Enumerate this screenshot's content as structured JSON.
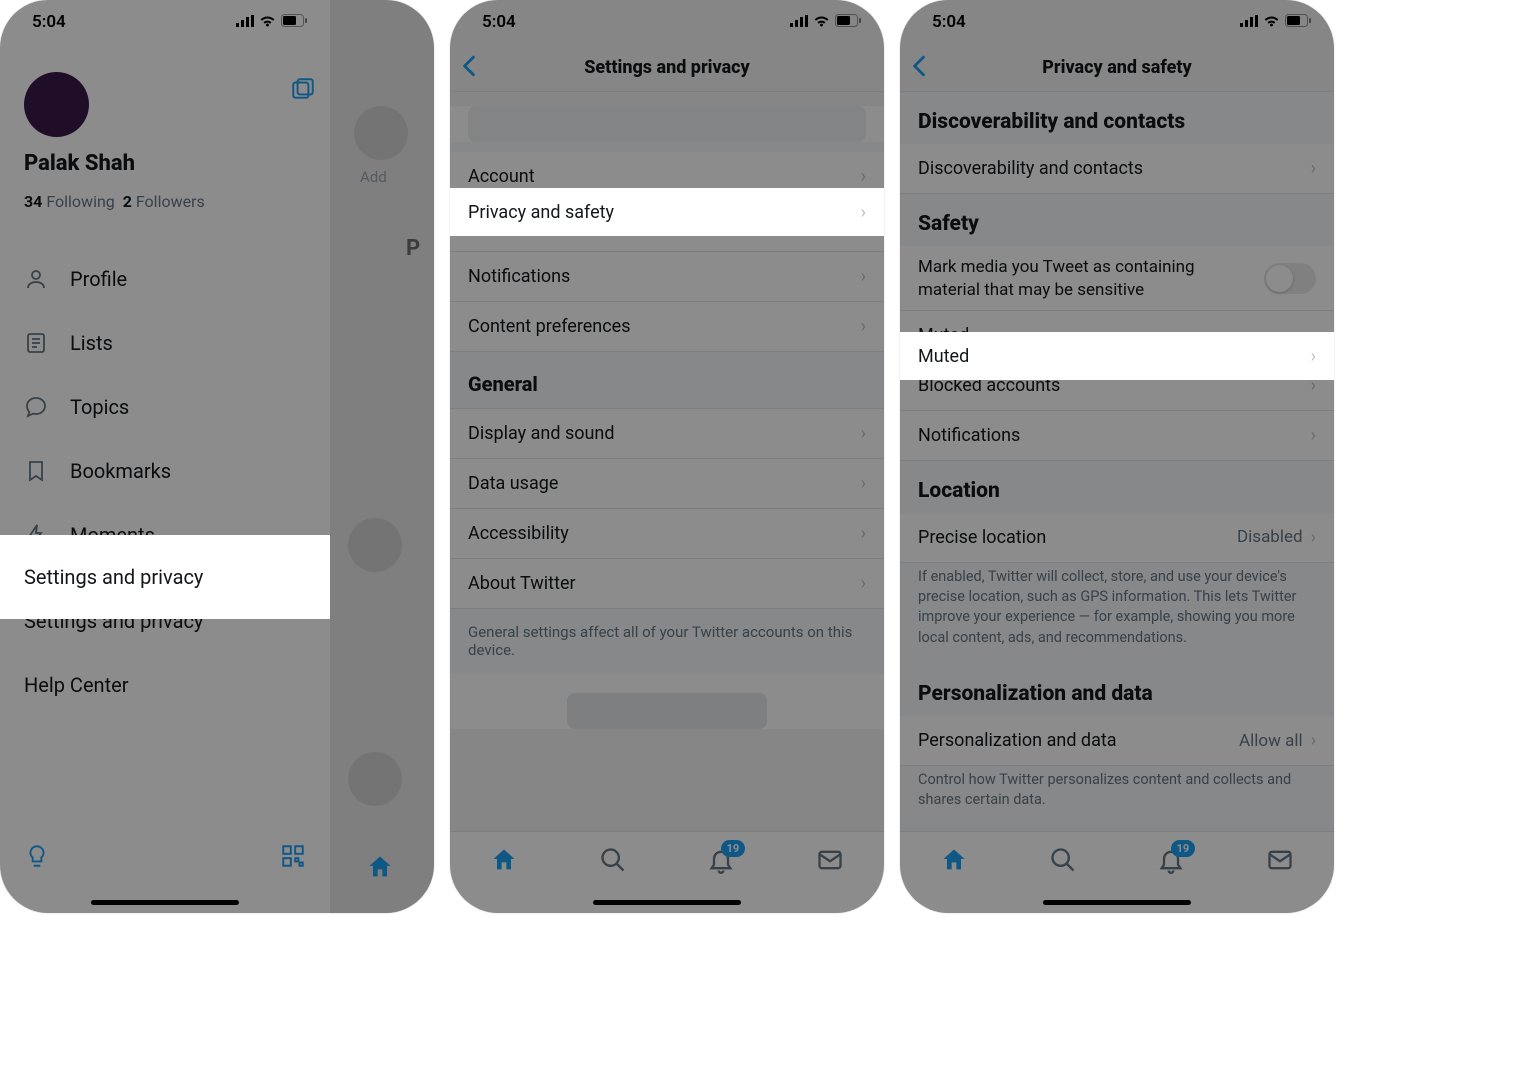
{
  "status": {
    "time": "5:04"
  },
  "screen1": {
    "username": "Palak Shah",
    "following_count": "34",
    "following_label": "Following",
    "followers_count": "2",
    "followers_label": "Followers",
    "menu": {
      "profile": "Profile",
      "lists": "Lists",
      "topics": "Topics",
      "bookmarks": "Bookmarks",
      "moments": "Moments"
    },
    "settings_privacy": "Settings and privacy",
    "help_center": "Help Center",
    "bg_add": "Add",
    "bg_p": "P"
  },
  "screen2": {
    "title": "Settings and privacy",
    "account": "Account",
    "privacy_safety": "Privacy and safety",
    "notifications": "Notifications",
    "content_prefs": "Content preferences",
    "general_header": "General",
    "display_sound": "Display and sound",
    "data_usage": "Data usage",
    "accessibility": "Accessibility",
    "about": "About Twitter",
    "footer": "General settings affect all of your Twitter accounts on this device.",
    "badge": "19"
  },
  "screen3": {
    "title": "Privacy and safety",
    "disc_header": "Discoverability and contacts",
    "disc_row": "Discoverability and contacts",
    "safety_header": "Safety",
    "sensitive": "Mark media you Tweet as containing material that may be sensitive",
    "muted": "Muted",
    "blocked": "Blocked accounts",
    "notifications": "Notifications",
    "location_header": "Location",
    "precise": "Precise location",
    "precise_value": "Disabled",
    "precise_desc": "If enabled, Twitter will collect, store, and use your device's precise location, such as GPS information. This lets Twitter improve your experience — for example, showing you more local content, ads, and recommendations.",
    "pers_header": "Personalization and data",
    "pers_row": "Personalization and data",
    "pers_value": "Allow all",
    "pers_desc": "Control how Twitter personalizes content and collects and shares certain data.",
    "badge": "19"
  }
}
